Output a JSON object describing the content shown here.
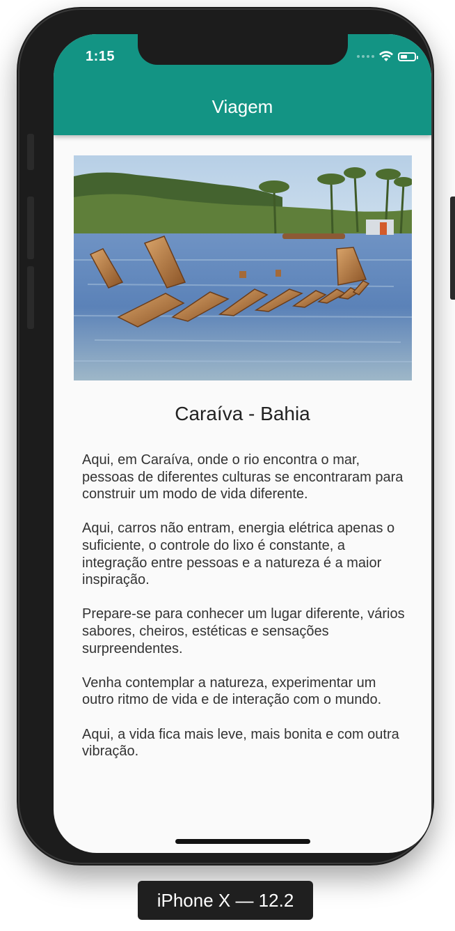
{
  "status_bar": {
    "time": "1:15",
    "icons": [
      "signal-dots-icon",
      "wifi-icon",
      "battery-icon"
    ]
  },
  "app_bar": {
    "title": "Viagem",
    "color": "#139484"
  },
  "article": {
    "image_alt": "Caraíva - Bahia",
    "title": "Caraíva - Bahia",
    "paragraphs": [
      "Aqui, em Caraíva, onde o rio encontra o mar, pessoas de diferentes culturas se encontraram para construir um modo de vida diferente.",
      "Aqui, carros não entram, energia elétrica apenas o suficiente, o controle do lixo é constante, a integração entre pessoas e a natureza é a maior inspiração.",
      "Prepare-se para conhecer um lugar diferente, vários sabores, cheiros, estéticas e sensações surpreendentes.",
      "Venha contemplar a natureza, experimentar um outro ritmo de vida e de interação com o mundo.",
      "Aqui, a vida fica mais leve, mais bonita e com outra vibração."
    ]
  },
  "simulator_label": "iPhone X — 12.2"
}
